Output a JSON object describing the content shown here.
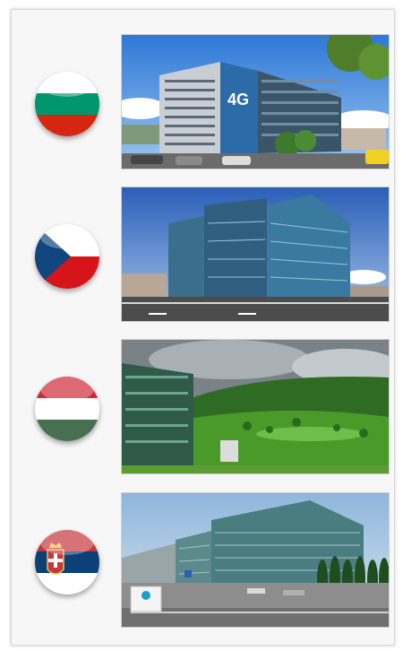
{
  "offices": [
    {
      "country": "Bulgaria",
      "flag_icon": "bulgaria-flag-icon",
      "sign_text": "4G",
      "colors": [
        "#ffffff",
        "#00966e",
        "#d62612"
      ]
    },
    {
      "country": "Czech Republic",
      "flag_icon": "czech-flag-icon",
      "sign_text": "",
      "colors": [
        "#ffffff",
        "#d7141a",
        "#11457e"
      ]
    },
    {
      "country": "Hungary",
      "flag_icon": "hungary-flag-icon",
      "sign_text": "",
      "colors": [
        "#ce2939",
        "#ffffff",
        "#477050"
      ]
    },
    {
      "country": "Serbia",
      "flag_icon": "serbia-flag-icon",
      "sign_text": "",
      "colors": [
        "#c6363c",
        "#0c4076",
        "#ffffff"
      ]
    }
  ]
}
